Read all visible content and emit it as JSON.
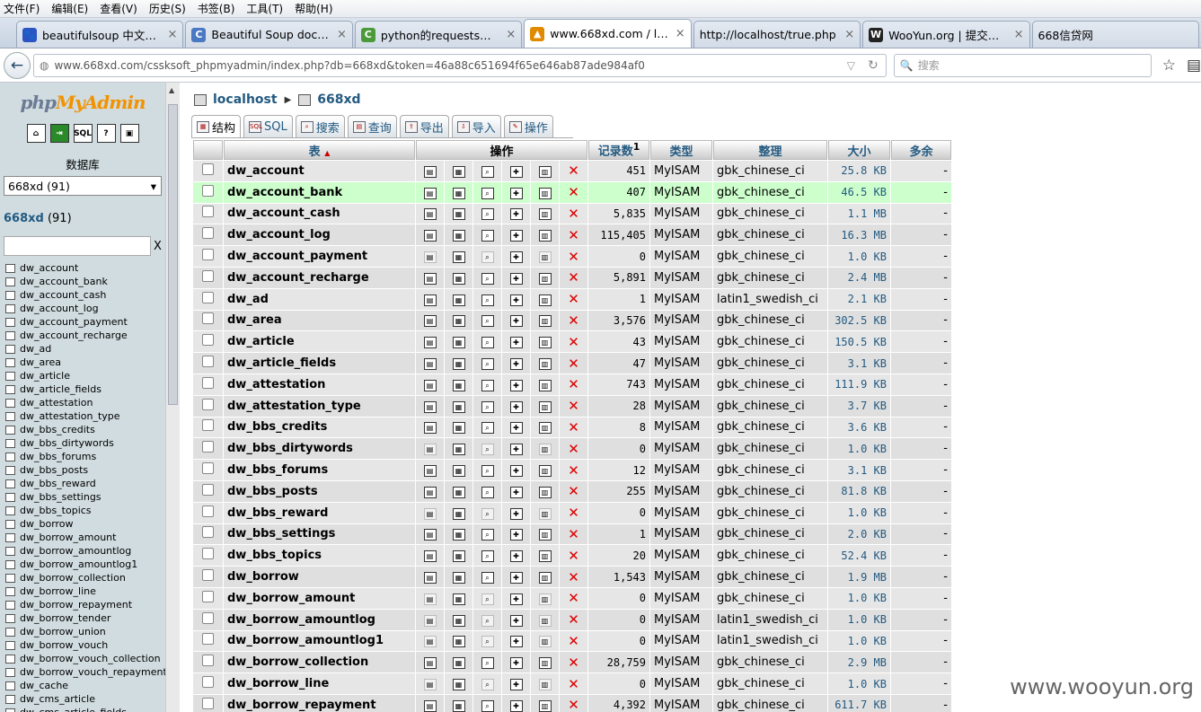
{
  "menu": [
    "文件(F)",
    "编辑(E)",
    "查看(V)",
    "历史(S)",
    "书签(B)",
    "工具(T)",
    "帮助(H)"
  ],
  "tabs": [
    {
      "title": "beautifulsoup 中文文档_...",
      "icon": "baidu-icon",
      "color": "#2a54c4",
      "glyph": "🐾",
      "active": false
    },
    {
      "title": "Beautiful Soup documen...",
      "icon": "doc-c-icon",
      "color": "#4a78c2",
      "glyph": "C",
      "active": false
    },
    {
      "title": "python的requests初步使...",
      "icon": "green-c-icon",
      "color": "#4a9a3a",
      "glyph": "C",
      "active": false
    },
    {
      "title": "www.668xd.com / localh...",
      "icon": "pma-icon",
      "color": "#e08a00",
      "glyph": "▲",
      "active": true
    },
    {
      "title": "http://localhost/true.php",
      "icon": "none",
      "color": "#fff",
      "glyph": "",
      "active": false
    },
    {
      "title": "WooYun.org | 提交漏洞",
      "icon": "wooyun-icon",
      "color": "#222",
      "glyph": "W",
      "active": false
    },
    {
      "title": "668信贷网",
      "icon": "none",
      "color": "#fff",
      "glyph": "",
      "active": false
    }
  ],
  "url": "www.668xd.com/cssksoft_phpmyadmin/index.php?db=668xd&token=46a88c651694f65e646ab87ade984af0",
  "search_placeholder": "搜索",
  "sidebar": {
    "logo_a": "php",
    "logo_b": "MyAdmin",
    "db_label": "数据库",
    "db_select": "668xd (91)",
    "db_name": "668xd",
    "db_count": "(91)",
    "filter_clear": "X",
    "tables": [
      "dw_account",
      "dw_account_bank",
      "dw_account_cash",
      "dw_account_log",
      "dw_account_payment",
      "dw_account_recharge",
      "dw_ad",
      "dw_area",
      "dw_article",
      "dw_article_fields",
      "dw_attestation",
      "dw_attestation_type",
      "dw_bbs_credits",
      "dw_bbs_dirtywords",
      "dw_bbs_forums",
      "dw_bbs_posts",
      "dw_bbs_reward",
      "dw_bbs_settings",
      "dw_bbs_topics",
      "dw_borrow",
      "dw_borrow_amount",
      "dw_borrow_amountlog",
      "dw_borrow_amountlog1",
      "dw_borrow_collection",
      "dw_borrow_line",
      "dw_borrow_repayment",
      "dw_borrow_tender",
      "dw_borrow_union",
      "dw_borrow_vouch",
      "dw_borrow_vouch_collection",
      "dw_borrow_vouch_repayment",
      "dw_cache",
      "dw_cms_article",
      "dw_cms_article_fields"
    ]
  },
  "breadcrumb": {
    "server": "localhost",
    "db": "668xd"
  },
  "ptabs": [
    "结构",
    "SQL",
    "搜索",
    "查询",
    "导出",
    "导入",
    "操作"
  ],
  "headers": {
    "table": "表",
    "sort": "▲",
    "ops": "操作",
    "rows": "记录数",
    "rows_sup": "1",
    "type": "类型",
    "collation": "整理",
    "size": "大小",
    "overhead": "多余"
  },
  "rows": [
    {
      "name": "dw_account",
      "rows": "451",
      "type": "MyISAM",
      "coll": "gbk_chinese_ci",
      "size": "25.8 KB",
      "over": "-",
      "empty": false
    },
    {
      "name": "dw_account_bank",
      "rows": "407",
      "type": "MyISAM",
      "coll": "gbk_chinese_ci",
      "size": "46.5 KB",
      "over": "-",
      "empty": false,
      "hl": true
    },
    {
      "name": "dw_account_cash",
      "rows": "5,835",
      "type": "MyISAM",
      "coll": "gbk_chinese_ci",
      "size": "1.1 MB",
      "over": "-",
      "empty": false
    },
    {
      "name": "dw_account_log",
      "rows": "115,405",
      "type": "MyISAM",
      "coll": "gbk_chinese_ci",
      "size": "16.3 MB",
      "over": "-",
      "empty": false
    },
    {
      "name": "dw_account_payment",
      "rows": "0",
      "type": "MyISAM",
      "coll": "gbk_chinese_ci",
      "size": "1.0 KB",
      "over": "-",
      "empty": true
    },
    {
      "name": "dw_account_recharge",
      "rows": "5,891",
      "type": "MyISAM",
      "coll": "gbk_chinese_ci",
      "size": "2.4 MB",
      "over": "-",
      "empty": false
    },
    {
      "name": "dw_ad",
      "rows": "1",
      "type": "MyISAM",
      "coll": "latin1_swedish_ci",
      "size": "2.1 KB",
      "over": "-",
      "empty": false
    },
    {
      "name": "dw_area",
      "rows": "3,576",
      "type": "MyISAM",
      "coll": "gbk_chinese_ci",
      "size": "302.5 KB",
      "over": "-",
      "empty": false
    },
    {
      "name": "dw_article",
      "rows": "43",
      "type": "MyISAM",
      "coll": "gbk_chinese_ci",
      "size": "150.5 KB",
      "over": "-",
      "empty": false
    },
    {
      "name": "dw_article_fields",
      "rows": "47",
      "type": "MyISAM",
      "coll": "gbk_chinese_ci",
      "size": "3.1 KB",
      "over": "-",
      "empty": false
    },
    {
      "name": "dw_attestation",
      "rows": "743",
      "type": "MyISAM",
      "coll": "gbk_chinese_ci",
      "size": "111.9 KB",
      "over": "-",
      "empty": false
    },
    {
      "name": "dw_attestation_type",
      "rows": "28",
      "type": "MyISAM",
      "coll": "gbk_chinese_ci",
      "size": "3.7 KB",
      "over": "-",
      "empty": false
    },
    {
      "name": "dw_bbs_credits",
      "rows": "8",
      "type": "MyISAM",
      "coll": "gbk_chinese_ci",
      "size": "3.6 KB",
      "over": "-",
      "empty": false
    },
    {
      "name": "dw_bbs_dirtywords",
      "rows": "0",
      "type": "MyISAM",
      "coll": "gbk_chinese_ci",
      "size": "1.0 KB",
      "over": "-",
      "empty": true
    },
    {
      "name": "dw_bbs_forums",
      "rows": "12",
      "type": "MyISAM",
      "coll": "gbk_chinese_ci",
      "size": "3.1 KB",
      "over": "-",
      "empty": false
    },
    {
      "name": "dw_bbs_posts",
      "rows": "255",
      "type": "MyISAM",
      "coll": "gbk_chinese_ci",
      "size": "81.8 KB",
      "over": "-",
      "empty": false
    },
    {
      "name": "dw_bbs_reward",
      "rows": "0",
      "type": "MyISAM",
      "coll": "gbk_chinese_ci",
      "size": "1.0 KB",
      "over": "-",
      "empty": true
    },
    {
      "name": "dw_bbs_settings",
      "rows": "1",
      "type": "MyISAM",
      "coll": "gbk_chinese_ci",
      "size": "2.0 KB",
      "over": "-",
      "empty": false
    },
    {
      "name": "dw_bbs_topics",
      "rows": "20",
      "type": "MyISAM",
      "coll": "gbk_chinese_ci",
      "size": "52.4 KB",
      "over": "-",
      "empty": false
    },
    {
      "name": "dw_borrow",
      "rows": "1,543",
      "type": "MyISAM",
      "coll": "gbk_chinese_ci",
      "size": "1.9 MB",
      "over": "-",
      "empty": false
    },
    {
      "name": "dw_borrow_amount",
      "rows": "0",
      "type": "MyISAM",
      "coll": "gbk_chinese_ci",
      "size": "1.0 KB",
      "over": "-",
      "empty": true
    },
    {
      "name": "dw_borrow_amountlog",
      "rows": "0",
      "type": "MyISAM",
      "coll": "latin1_swedish_ci",
      "size": "1.0 KB",
      "over": "-",
      "empty": true
    },
    {
      "name": "dw_borrow_amountlog1",
      "rows": "0",
      "type": "MyISAM",
      "coll": "latin1_swedish_ci",
      "size": "1.0 KB",
      "over": "-",
      "empty": true
    },
    {
      "name": "dw_borrow_collection",
      "rows": "28,759",
      "type": "MyISAM",
      "coll": "gbk_chinese_ci",
      "size": "2.9 MB",
      "over": "-",
      "empty": false
    },
    {
      "name": "dw_borrow_line",
      "rows": "0",
      "type": "MyISAM",
      "coll": "gbk_chinese_ci",
      "size": "1.0 KB",
      "over": "-",
      "empty": true
    },
    {
      "name": "dw_borrow_repayment",
      "rows": "4,392",
      "type": "MyISAM",
      "coll": "gbk_chinese_ci",
      "size": "611.7 KB",
      "over": "-",
      "empty": false
    }
  ],
  "watermark": "www.wooyun.org"
}
